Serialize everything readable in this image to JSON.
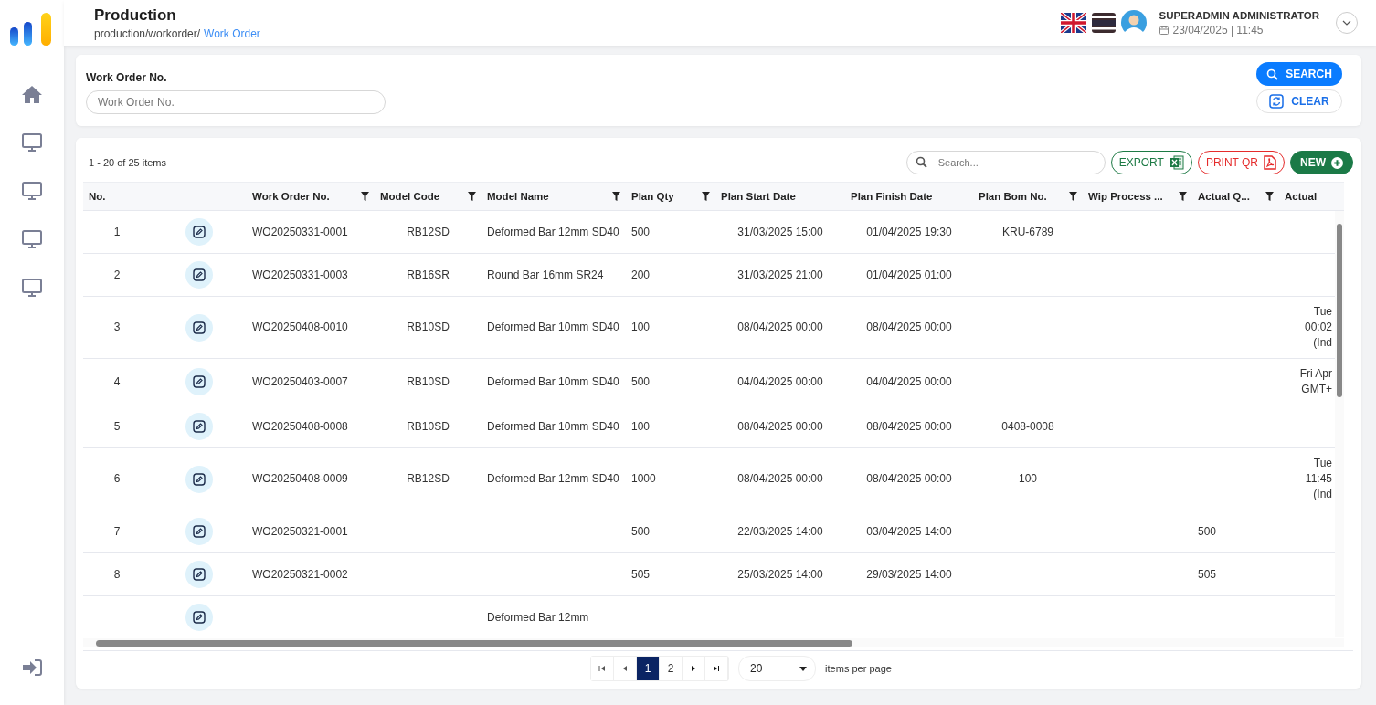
{
  "header": {
    "title": "Production",
    "breadcrumb": "production/workorder/",
    "breadcrumb_link": "Work Order",
    "user_name": "SUPERADMIN ADMINISTRATOR",
    "datetime": "23/04/2025 | 11:45"
  },
  "sidebar": {
    "items": [
      {
        "kind": "home"
      },
      {
        "kind": "monitor"
      },
      {
        "kind": "monitor"
      },
      {
        "kind": "monitor"
      },
      {
        "kind": "monitor"
      }
    ]
  },
  "filter": {
    "label": "Work Order No.",
    "placeholder": "Work Order No.",
    "buttons": [
      {
        "kind": "search",
        "label": "SEARCH"
      },
      {
        "kind": "clear",
        "label": "CLEAR"
      }
    ]
  },
  "table": {
    "summary": "1 - 20 of 25 items",
    "search_placeholder": "Search...",
    "actions": [
      {
        "kind": "export",
        "label": "EXPORT"
      },
      {
        "kind": "print",
        "label": "PRINT QR"
      },
      {
        "kind": "new",
        "label": "NEW"
      }
    ],
    "columns": [
      {
        "label": "No.",
        "filterable": false
      },
      {
        "label": "Work Order No.",
        "filterable": true
      },
      {
        "label": "Model Code",
        "filterable": true
      },
      {
        "label": "Model Name",
        "filterable": true
      },
      {
        "label": "Plan Qty",
        "filterable": true
      },
      {
        "label": "Plan Start Date",
        "filterable": false
      },
      {
        "label": "Plan Finish Date",
        "filterable": false
      },
      {
        "label": "Plan Bom No.",
        "filterable": true
      },
      {
        "label": "Wip Process ...",
        "filterable": true
      },
      {
        "label": "Actual Q...",
        "filterable": true
      },
      {
        "label": "Actual",
        "filterable": false
      }
    ],
    "rows": [
      [
        "1",
        "WO20250331-0001",
        "RB12SD",
        "Deformed Bar 12mm SD40",
        "500",
        "31/03/2025 15:00",
        "01/04/2025 19:30",
        "KRU-6789",
        null,
        null,
        null
      ],
      [
        "2",
        "WO20250331-0003",
        "RB16SR",
        "Round Bar 16mm SR24",
        "200",
        "31/03/2025 21:00",
        "01/04/2025 01:00",
        null,
        null,
        null,
        null
      ],
      [
        "3",
        "WO20250408-0010",
        "RB10SD",
        "Deformed Bar 10mm SD40",
        "100",
        "08/04/2025 00:00",
        "08/04/2025 00:00",
        null,
        null,
        null,
        "Tue\n00:02\n(Ind"
      ],
      [
        "4",
        "WO20250403-0007",
        "RB10SD",
        "Deformed Bar 10mm SD40",
        "500",
        "04/04/2025 00:00",
        "04/04/2025 00:00",
        null,
        null,
        null,
        "Fri Apr\nGMT+"
      ],
      [
        "5",
        "WO20250408-0008",
        "RB10SD",
        "Deformed Bar 10mm SD40",
        "100",
        "08/04/2025 00:00",
        "08/04/2025 00:00",
        "0408-0008",
        null,
        null,
        null
      ],
      [
        "6",
        "WO20250408-0009",
        "RB12SD",
        "Deformed Bar 12mm SD40",
        "1000",
        "08/04/2025 00:00",
        "08/04/2025 00:00",
        "100",
        null,
        null,
        "Tue\n11:45\n(Ind"
      ],
      [
        "7",
        "WO20250321-0001",
        null,
        null,
        "500",
        "22/03/2025 14:00",
        "03/04/2025 14:00",
        null,
        null,
        "500",
        null
      ],
      [
        "8",
        "WO20250321-0002",
        null,
        null,
        "505",
        "25/03/2025 14:00",
        "29/03/2025 14:00",
        null,
        null,
        "505",
        null
      ],
      [
        null,
        null,
        null,
        "Deformed Bar 12mm",
        null,
        null,
        null,
        null,
        null,
        null,
        null
      ]
    ],
    "pages": [
      {
        "label": "1",
        "selected": true
      },
      {
        "label": "2",
        "selected": false
      }
    ],
    "page_size": "20",
    "page_size_label": "items per page"
  }
}
